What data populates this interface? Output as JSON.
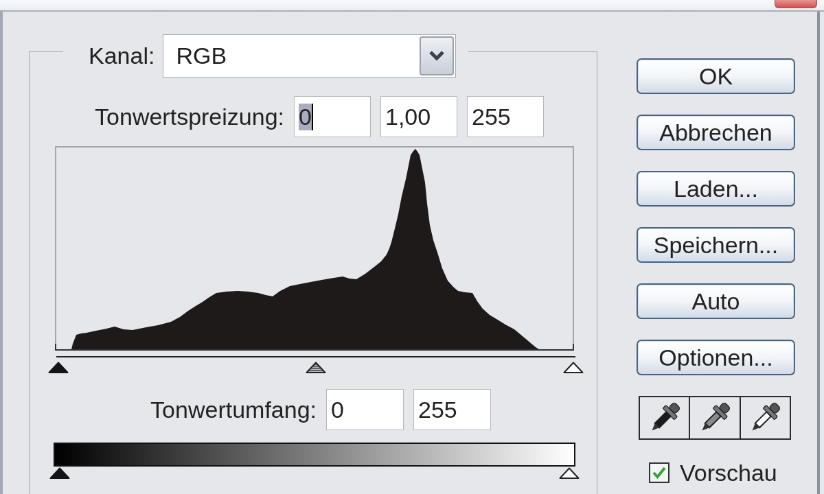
{
  "channel": {
    "label": "Kanal:",
    "value": "RGB"
  },
  "input_levels": {
    "label": "Tonwertspreizung:",
    "fields": [
      {
        "value": "0",
        "focused": true
      },
      {
        "value": "1,00",
        "focused": false
      },
      {
        "value": "255",
        "focused": false
      }
    ]
  },
  "input_slider": {
    "thumbs": [
      {
        "kind": "black",
        "level": 0
      },
      {
        "kind": "gray",
        "level": 0.5
      },
      {
        "kind": "white",
        "level": 1
      }
    ]
  },
  "output_levels": {
    "label": "Tonwertumfang:",
    "fields": [
      {
        "value": "0",
        "focused": false
      },
      {
        "value": "255",
        "focused": false
      }
    ]
  },
  "output_slider": {
    "thumbs": [
      {
        "kind": "black",
        "level": 0
      },
      {
        "kind": "white",
        "level": 1
      }
    ]
  },
  "buttons": [
    {
      "label": "OK"
    },
    {
      "label": "Abbrechen"
    },
    {
      "label": "Laden..."
    },
    {
      "label": "Speichern..."
    },
    {
      "label": "Auto"
    },
    {
      "label": "Optionen..."
    }
  ],
  "eyedroppers": [
    {
      "kind": "black"
    },
    {
      "kind": "gray"
    },
    {
      "kind": "white"
    }
  ],
  "preview": {
    "label": "Vorschau",
    "checked": true
  }
}
